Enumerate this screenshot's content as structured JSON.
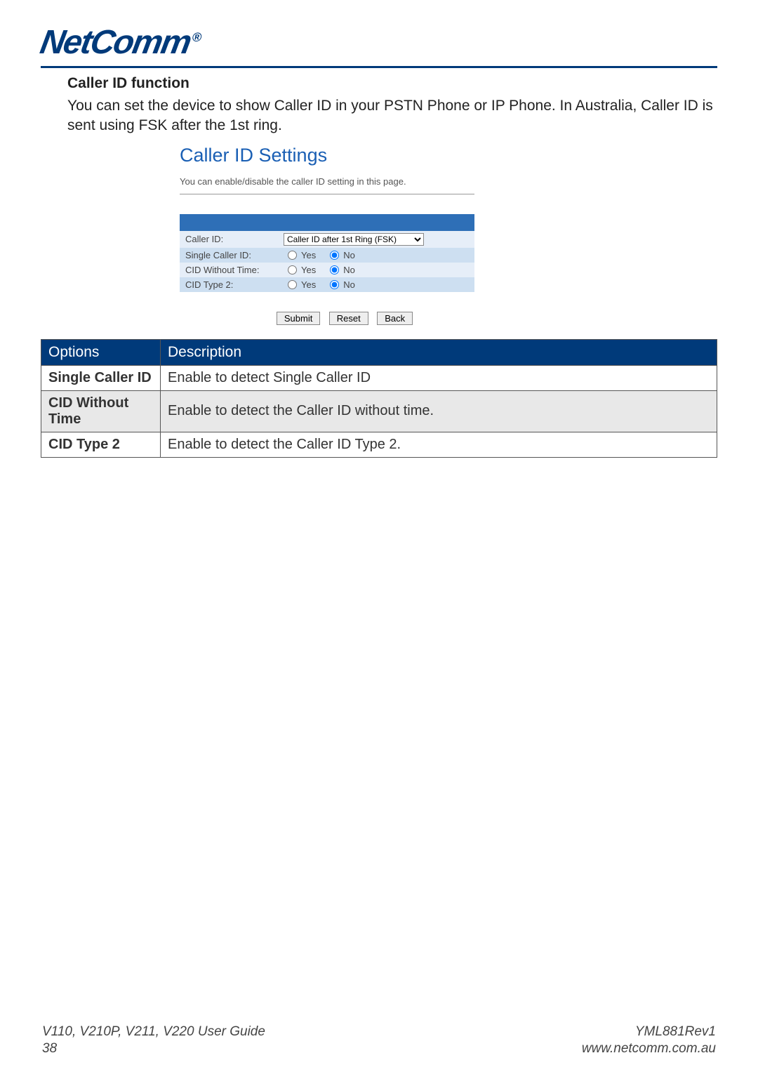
{
  "logo_text": "NetComm",
  "logo_reg": "®",
  "section": {
    "title": "Caller ID function",
    "body": "You can set the device to show Caller ID in your PSTN Phone or IP Phone. In Australia, Caller ID is sent using FSK after the 1st ring."
  },
  "panel": {
    "title": "Caller ID Settings",
    "hint": "You can enable/disable the caller ID setting in this page.",
    "rows": {
      "caller_id_label": "Caller ID:",
      "caller_id_value": "Caller ID after 1st Ring (FSK)",
      "single_label": "Single Caller ID:",
      "cid_wo_time_label": "CID Without Time:",
      "cid_type2_label": "CID Type 2:",
      "yes": "Yes",
      "no": "No"
    },
    "buttons": {
      "submit": "Submit",
      "reset": "Reset",
      "back": "Back"
    }
  },
  "table": {
    "headers": {
      "options": "Options",
      "description": "Description"
    },
    "rows": [
      {
        "opt": "Single Caller ID",
        "desc": "Enable to detect Single Caller ID"
      },
      {
        "opt": "CID Without Time",
        "desc": "Enable to detect the Caller ID without time."
      },
      {
        "opt": "CID Type 2",
        "desc": "Enable to detect the Caller ID Type 2."
      }
    ]
  },
  "footer": {
    "guide": "V110, V210P, V211, V220 User Guide",
    "page": "38",
    "rev": "YML881Rev1",
    "url": "www.netcomm.com.au"
  }
}
